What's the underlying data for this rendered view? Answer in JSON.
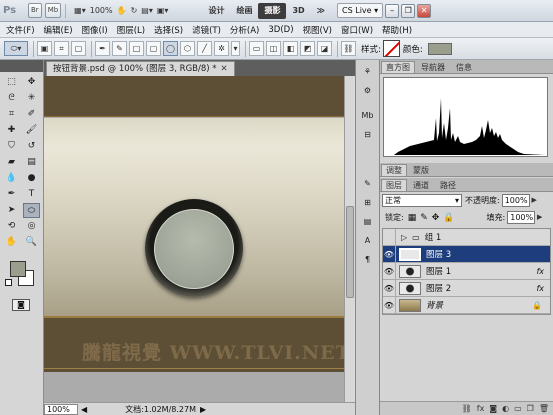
{
  "titlebar": {
    "app_logo": "Ps",
    "bridge": "Br",
    "minibridge": "Mb",
    "zoom": "100%",
    "workspaces": [
      "设计",
      "绘画",
      "摄影",
      "3D"
    ],
    "active_workspace": "摄影",
    "more": "≫",
    "cs_live": "CS Live ▾"
  },
  "menubar": {
    "items": [
      "文件(F)",
      "编辑(E)",
      "图像(I)",
      "图层(L)",
      "选择(S)",
      "滤镜(T)",
      "分析(A)",
      "3D(D)",
      "视图(V)",
      "窗口(W)",
      "帮助(H)"
    ]
  },
  "options_bar": {
    "style_label": "样式:",
    "color_label": "颜色:",
    "fill_color": "#9a9e8d"
  },
  "toolbox": {
    "foreground_color": "#9a9e8d",
    "background_color": "#ffffff"
  },
  "document": {
    "tab_title": "按钮背景.psd @ 100% (图层 3, RGB/8) *",
    "watermark": "騰龍視覺 WWW.TLVI.NET"
  },
  "status": {
    "zoom": "100%",
    "doc_info": "文档:1.02M/8.27M"
  },
  "panels": {
    "top_tabs": [
      "直方图",
      "导航器",
      "信息"
    ],
    "mid_tabs": [
      "调整",
      "蒙版"
    ],
    "layer_tabs": [
      "图层",
      "通道",
      "路径"
    ],
    "blend_mode": "正常",
    "opacity_label": "不透明度:",
    "opacity": "100%",
    "lock_label": "锁定:",
    "fill_label": "填充:",
    "fill": "100%"
  },
  "layers": [
    {
      "name": "组 1",
      "type": "group"
    },
    {
      "name": "图层 3",
      "selected": true
    },
    {
      "name": "图层 1",
      "fx": "fx"
    },
    {
      "name": "图层 2",
      "fx": "fx"
    },
    {
      "name": "背景",
      "locked": true
    }
  ]
}
